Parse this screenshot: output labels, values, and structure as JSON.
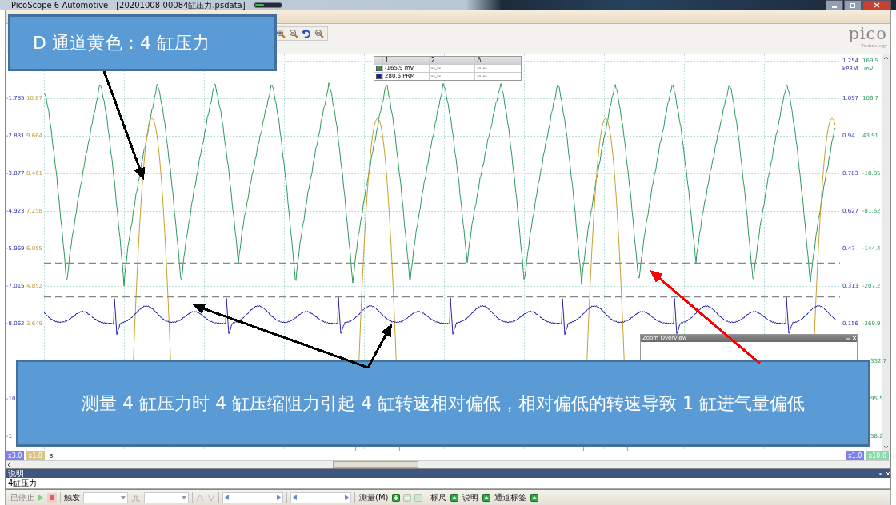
{
  "window": {
    "title": "PicoScope 6 Automotive - [20201008-00084缸压力.psdata]"
  },
  "logo": {
    "name": "pico",
    "tagline": "Technology"
  },
  "measurements": {
    "columns": [
      "1",
      "2",
      "Δ"
    ],
    "rows": [
      {
        "color": "#2e9a5e",
        "values": [
          "-165.9 mV",
          "--.--",
          "--.--"
        ]
      },
      {
        "color": "#1c1cb0",
        "values": [
          "280.6 PRM",
          "--.--",
          "--.--"
        ]
      }
    ]
  },
  "left_axis": [
    {
      "a": "-1.785",
      "b": "10.87"
    },
    {
      "a": "-2.831",
      "b": "9.664"
    },
    {
      "a": "-3.877",
      "b": "8.461"
    },
    {
      "a": "-4.923",
      "b": "7.258"
    },
    {
      "a": "-5.969",
      "b": "6.055"
    },
    {
      "a": "-7.015",
      "b": "4.852"
    },
    {
      "a": "-8.062",
      "b": "3.649"
    }
  ],
  "left_axis_fragments": [
    "-10",
    "-1"
  ],
  "right_axis": [
    {
      "a": "1.254",
      "b": "169.5"
    },
    {
      "a": "1.097",
      "b": "106.7"
    },
    {
      "a": "0.94",
      "b": "43.91"
    },
    {
      "a": "0.783",
      "b": "-18.85"
    },
    {
      "a": "0.627",
      "b": "-81.62"
    },
    {
      "a": "0.47",
      "b": "-144.4"
    },
    {
      "a": "0.313",
      "b": "-207.2"
    },
    {
      "a": "0.156",
      "b": "-269.9"
    }
  ],
  "right_units": [
    "kPRM",
    "mV"
  ],
  "right_axis_fragments": [
    "332.7",
    "95.5",
    "58.2"
  ],
  "zoom_overview": {
    "title": "Zoom Overview"
  },
  "x_axis": {
    "left_chips": [
      {
        "label": "x3.0",
        "color": "#8080f0"
      },
      {
        "label": "x1.0",
        "color": "#d8c488"
      }
    ],
    "unit": "s",
    "right_chips": [
      {
        "label": "x1.0",
        "color": "#8080f0"
      },
      {
        "label": "x10.0",
        "color": "#8cd8a8"
      }
    ]
  },
  "notes": {
    "title": "说明",
    "text": "4缸压力"
  },
  "bottom_toolbar": {
    "status": "已停止",
    "trigger": "触发",
    "measure": "测量(M)",
    "ruler": "标尺",
    "notes": "说明",
    "channel_labels": "通道标签"
  },
  "callouts": [
    {
      "text": "D 通道黄色：4 缸压力"
    },
    {
      "text": "测量 4 缸压力时 4 缸压缩阻力引起 4 缸转速相对偏低，相对偏低的转速导致 1 缸进气量偏低"
    }
  ],
  "arrows": [
    {
      "color": "#000000"
    },
    {
      "color": "#000000"
    },
    {
      "color": "#000000"
    },
    {
      "color": "#ff0000"
    }
  ]
}
